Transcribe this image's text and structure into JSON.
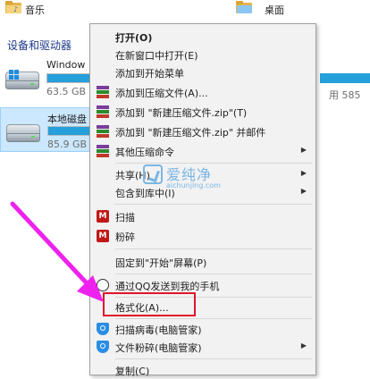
{
  "explorer": {
    "libraries": [
      {
        "label": "音乐",
        "icon": "music-folder-icon"
      },
      {
        "label": "桌面",
        "icon": "desktop-folder-icon"
      }
    ],
    "section_title": "设备和驱动器",
    "drives": [
      {
        "name": "Windows (C:)",
        "name_visible": "Window",
        "size_text": "63.5 GB",
        "used_fraction": 0.9,
        "icon": "windows-drive-icon",
        "selected": false
      },
      {
        "name": "本地磁盘",
        "size_text": "85.9 GB",
        "used_fraction": 0.9,
        "icon": "hard-drive-icon",
        "selected": true
      }
    ],
    "right_free_text": "用 585"
  },
  "context_menu": {
    "items": [
      {
        "label": "打开(O)",
        "bold": true,
        "icon": null,
        "submenu": false
      },
      {
        "label": "在新窗口中打开(E)",
        "bold": false,
        "icon": null,
        "submenu": false
      },
      {
        "label": "添加到开始菜单",
        "bold": false,
        "icon": null,
        "submenu": false
      },
      {
        "label": "添加到压缩文件(A)...",
        "bold": false,
        "icon": "winrar-icon",
        "submenu": false
      },
      {
        "label": "添加到 \"新建压缩文件.zip\"(T)",
        "bold": false,
        "icon": "winrar-icon",
        "submenu": false
      },
      {
        "label": "添加到 \"新建压缩文件.zip\" 并邮件",
        "bold": false,
        "icon": "winrar-icon",
        "submenu": false
      },
      {
        "label": "其他压缩命令",
        "bold": false,
        "icon": "winrar-icon",
        "submenu": true
      },
      {
        "label": "共享(H)",
        "bold": false,
        "icon": null,
        "submenu": true
      },
      {
        "label": "包含到库中(I)",
        "bold": false,
        "icon": null,
        "submenu": true
      },
      {
        "label": "扫描",
        "bold": false,
        "icon": "mcafee-icon",
        "submenu": false
      },
      {
        "label": "粉碎",
        "bold": false,
        "icon": "mcafee-icon",
        "submenu": false
      },
      {
        "label": "固定到\"开始\"屏幕(P)",
        "bold": false,
        "icon": null,
        "submenu": false
      },
      {
        "label": "通过QQ发送到我的手机",
        "bold": false,
        "icon": "qq-icon",
        "submenu": false
      },
      {
        "label": "格式化(A)...",
        "bold": false,
        "icon": null,
        "submenu": false,
        "highlighted": true
      },
      {
        "label": "扫描病毒(电脑管家)",
        "bold": false,
        "icon": "tencent-guard-icon",
        "submenu": false
      },
      {
        "label": "文件粉碎(电脑管家)",
        "bold": false,
        "icon": "tencent-guard-icon",
        "submenu": true
      },
      {
        "label": "复制(C)",
        "bold": false,
        "icon": null,
        "submenu": false
      }
    ]
  },
  "watermark": {
    "brand": "爱纯净",
    "url": "aichunjing.com"
  },
  "colors": {
    "menu_bg": "#f2f2f2",
    "highlight_border": "#e0142b",
    "annotation_arrow": "#ee22ee",
    "drive_bar": "#26a0da",
    "selected_tile": "#cce8ff"
  }
}
